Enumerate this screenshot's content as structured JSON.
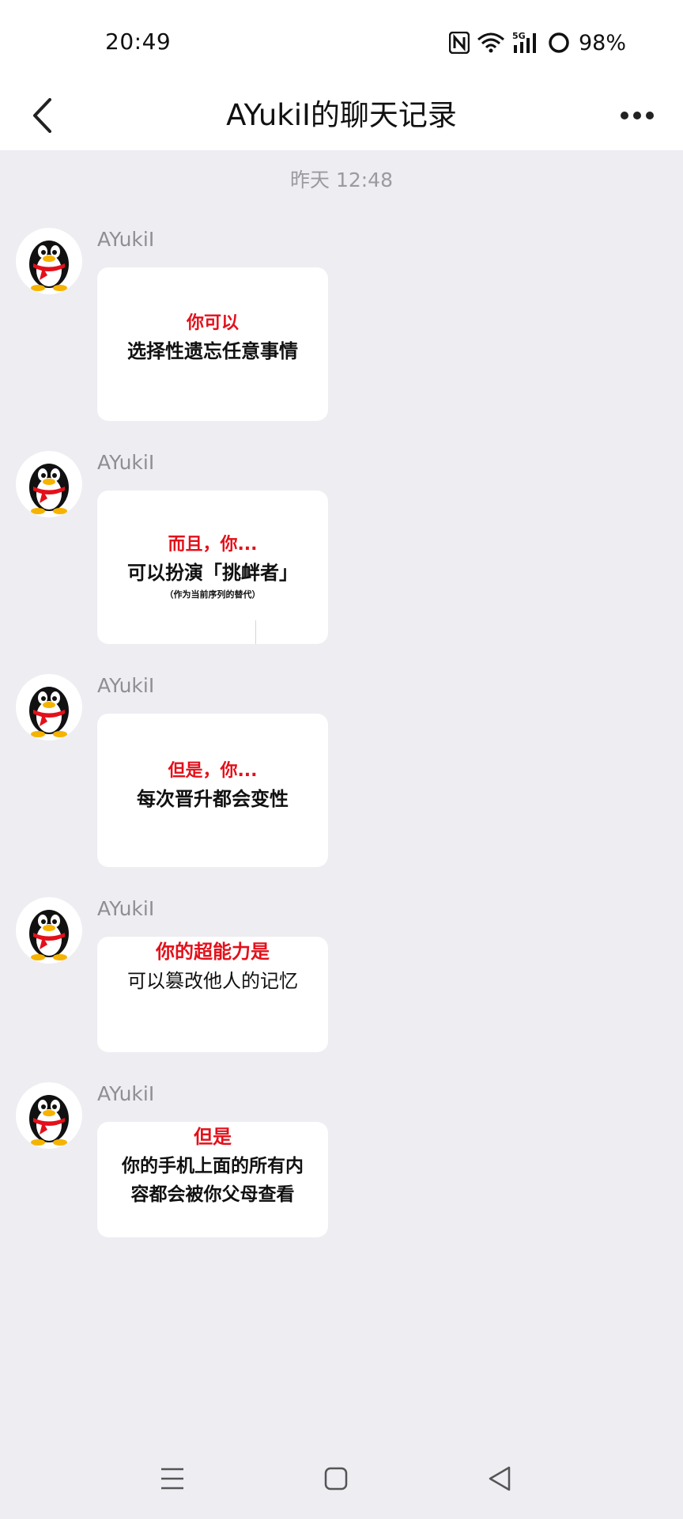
{
  "status": {
    "time": "20:49",
    "battery": "98%",
    "network": "5G"
  },
  "nav": {
    "title": "AYukiI的聊天记录",
    "back_icon": "chevron-left-icon",
    "more_icon": "more-dots-icon"
  },
  "chat": {
    "timestamp": "昨天 12:48",
    "messages": [
      {
        "sender": "AYukiI",
        "lines": [
          {
            "style": "red",
            "text": "你可以"
          },
          {
            "style": "black",
            "text": "选择性遗忘任意事情"
          }
        ]
      },
      {
        "sender": "AYukiI",
        "lines": [
          {
            "style": "red",
            "text": "而且，你..."
          },
          {
            "style": "black",
            "text": "可以扮演「挑衅者」"
          },
          {
            "style": "small",
            "text": "（作为当前序列的替代）"
          }
        ]
      },
      {
        "sender": "AYukiI",
        "lines": [
          {
            "style": "red",
            "text": "但是，你..."
          },
          {
            "style": "black",
            "text": "每次晋升都会变性"
          }
        ]
      },
      {
        "sender": "AYukiI",
        "lines": [
          {
            "style": "red",
            "text": "你的超能力是"
          },
          {
            "style": "black",
            "text": "可以篡改他人的记忆"
          }
        ]
      },
      {
        "sender": "AYukiI",
        "lines": [
          {
            "style": "red",
            "text": "但是"
          },
          {
            "style": "black",
            "text": "你的手机上面的所有内"
          },
          {
            "style": "black",
            "text": "容都会被你父母查看"
          }
        ]
      }
    ]
  },
  "system_nav": {
    "menu_icon": "menu-icon",
    "home_icon": "home-square-icon",
    "back_icon": "back-triangle-icon"
  }
}
